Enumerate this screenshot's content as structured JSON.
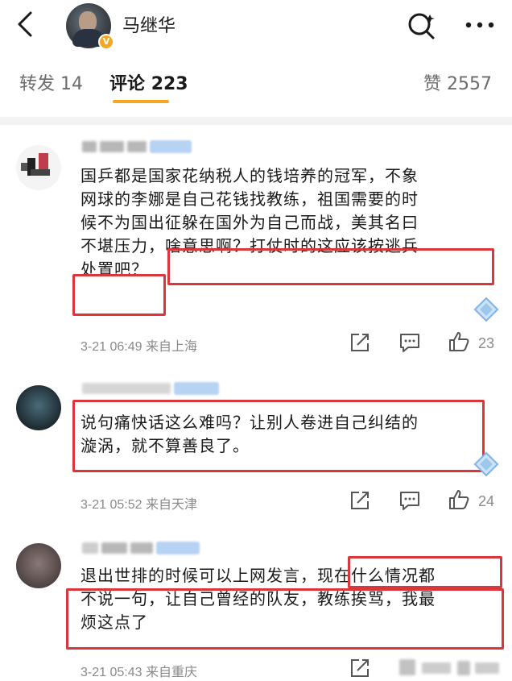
{
  "header": {
    "username": "马继华",
    "back_icon": "chevron-left-icon",
    "search_icon": "search-icon",
    "more_icon": "more-icon"
  },
  "tabs": [
    {
      "label": "转发",
      "count": "14"
    },
    {
      "label": "评论",
      "count": "223"
    },
    {
      "label": "赞",
      "count": "2557"
    }
  ],
  "comments": [
    {
      "text_lines": [
        "国乒都是国家花纳税人的钱培养的冠军，不象",
        "网球的李娜是自己花钱找教练，祖国需要的时",
        "候不为国出征躲在国外为自己而战，美其名曰",
        "不堪压力，啥意思啊？打仗时的这应该按逃兵",
        "处置吧？"
      ],
      "time": "3-21 06:49",
      "location": "来自上海",
      "likes": "23"
    },
    {
      "text_lines": [
        "说句痛快话这么难吗？让别人卷进自己纠结的",
        "漩涡，就不算善良了。"
      ],
      "time": "3-21 05:52",
      "location": "来自天津",
      "likes": "24"
    },
    {
      "text_lines": [
        "退出世排的时候可以上网发言，现在什么情况都",
        "不说一句，让自己曾经的队友，教练挨骂，我最",
        "烦这点了"
      ],
      "time": "3-21 05:43",
      "location": "来自重庆",
      "likes": ""
    }
  ],
  "colors": {
    "accent": "#f5a623",
    "highlight_box": "#d9373b",
    "meta_text": "#8a8a8a"
  }
}
